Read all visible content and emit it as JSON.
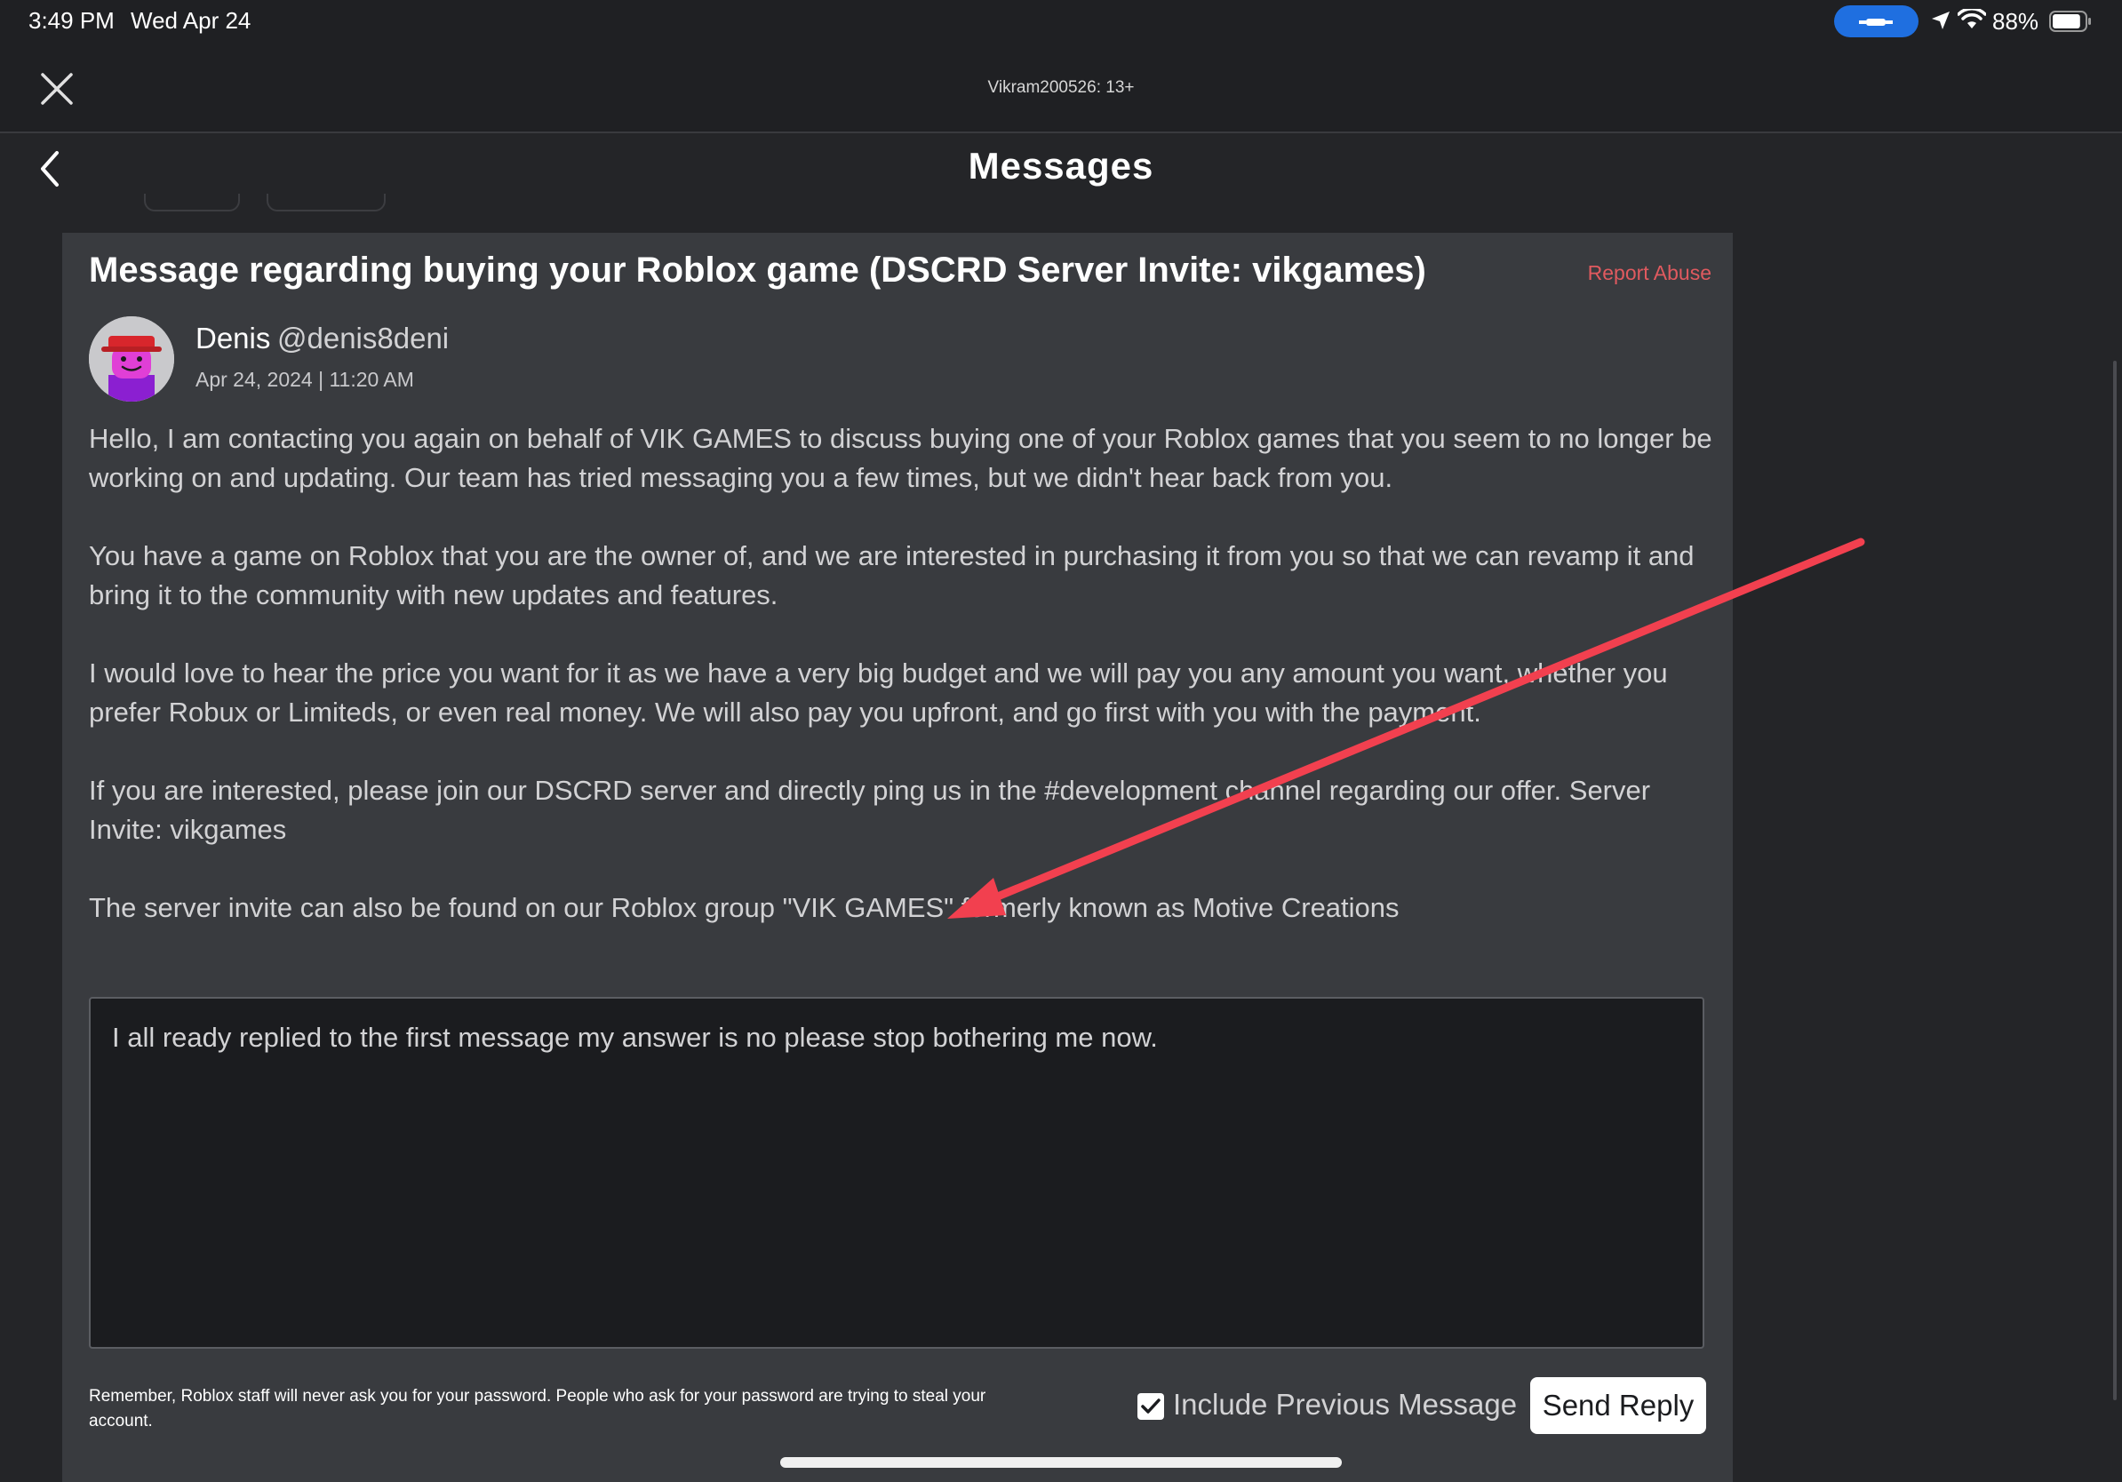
{
  "status_bar": {
    "time": "3:49 PM",
    "date": "Wed Apr 24",
    "battery_percent": "88%",
    "battery_level": 0.88
  },
  "topbar": {
    "account_label": "Vikram200526: 13+",
    "close_icon": "close-icon"
  },
  "header": {
    "title": "Messages",
    "back_icon": "chevron-left-icon"
  },
  "message": {
    "subject": "Message regarding buying your Roblox game (DSCRD Server Invite: vikgames)",
    "report_label": "Report Abuse",
    "sender": {
      "name": "Denis",
      "handle": "@denis8deni",
      "date": "Apr 24, 2024 | 11:20 AM",
      "avatar_icon": "roblox-avatar-icon"
    },
    "paragraphs": [
      "Hello, I am contacting you again on behalf of VIK GAMES to discuss buying one of your Roblox games that you seem to no longer be working on and updating. Our team has tried messaging you a few times, but we didn't hear back from you.",
      "You have a game on Roblox that you are the owner of, and we are interested in purchasing it from you so that we can revamp it and bring it to the community with new updates and features.",
      "I would love to hear the price you want for it as we have a very big budget and we will pay you any amount you want, whether you prefer Robux or Limiteds, or even real money. We will also pay you upfront, and go first with you with the payment.",
      "If you are interested, please join our DSCRD server and directly ping us in the #development channel regarding our offer. Server Invite: vikgames",
      "The server invite can also be found on our Roblox group \"VIK GAMES\" formerly known as Motive Creations"
    ]
  },
  "reply": {
    "value": "I all ready replied to the first message my answer is no please stop bothering me now.",
    "warning": "Remember, Roblox staff will never ask you for your password. People who ask for your password are trying to steal your account.",
    "include_previous_label": "Include Previous Message",
    "include_previous_checked": true,
    "send_label": "Send Reply"
  },
  "colors": {
    "background": "#242528",
    "card": "#393b3f",
    "report_abuse": "#e05a5f",
    "annotation_arrow": "#f2404f",
    "status_pill": "#1f6fe0"
  }
}
